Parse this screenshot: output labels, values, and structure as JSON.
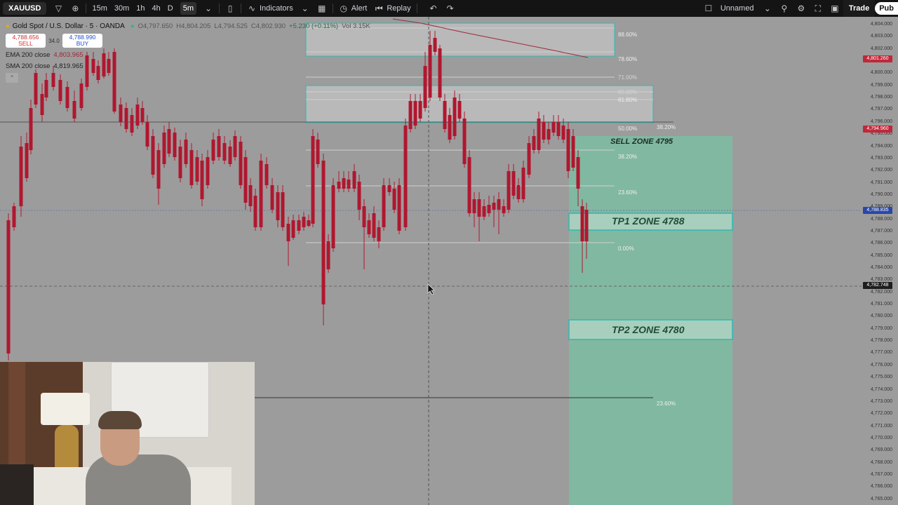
{
  "toolbar": {
    "symbol": "XAUUSD",
    "intervals": [
      "15m",
      "30m",
      "1h",
      "4h",
      "D",
      "5m"
    ],
    "active_interval": "5m",
    "indicators_label": "Indicators",
    "alert_label": "Alert",
    "replay_label": "Replay",
    "layout_name": "Unnamed",
    "trade_label": "Trade",
    "publish_label": "Pub"
  },
  "legend": {
    "title": "Gold Spot / U.S. Dollar · 5 · OANDA",
    "open": "O4,797.650",
    "high": "H4,804.205",
    "low": "L4,794.525",
    "close": "C4,802.930",
    "change": "+5.230 (+0.11%)",
    "volume": "Vol 3.15K",
    "sell_price": "4,788.656",
    "sell_label": "SELL",
    "spread": "34.0",
    "buy_price": "4,788.990",
    "buy_label": "BUY",
    "ema_label": "EMA 200 close",
    "ema_value": "4,803.965",
    "sma_label": "SMA 200 close",
    "sma_value": "4,819.965"
  },
  "zones": {
    "sell_zone": "SELL ZONE 4795",
    "tp1_zone": "TP1 ZONE 4788",
    "tp2_zone": "TP2 ZONE 4780"
  },
  "fib_levels": [
    "88.60%",
    "78.60%",
    "71.00%",
    "65.00%",
    "61.80%",
    "50.00%",
    "38.20%",
    "38.20%",
    "23.60%",
    "0.00%",
    "23.60%"
  ],
  "price_axis": {
    "ticks": [
      "4,804.000",
      "4,803.000",
      "4,802.000",
      "4,801.000",
      "4,800.000",
      "4,799.000",
      "4,798.000",
      "4,797.000",
      "4,796.000",
      "4,795.000",
      "4,794.000",
      "4,793.000",
      "4,792.000",
      "4,791.000",
      "4,790.000",
      "4,789.000",
      "4,788.000",
      "4,787.000",
      "4,786.000",
      "4,785.000",
      "4,784.000",
      "4,783.000",
      "4,782.000",
      "4,781.000",
      "4,780.000",
      "4,779.000",
      "4,778.000",
      "4,777.000",
      "4,776.000",
      "4,775.000",
      "4,774.000",
      "4,773.000",
      "4,772.000",
      "4,771.000",
      "4,770.000",
      "4,769.000",
      "4,768.000",
      "4,767.000",
      "4,766.000",
      "4,765.000"
    ],
    "badge_red_1": "4,801.260",
    "badge_red_2": "4,794.960",
    "badge_blue": "4,788.835",
    "badge_dark": "4,782.748",
    "colors": {
      "bull": "#1f3fc4",
      "bear": "#b0172f",
      "zone_green": "#7fb9a2",
      "zone_border": "#2fb8b0"
    }
  }
}
